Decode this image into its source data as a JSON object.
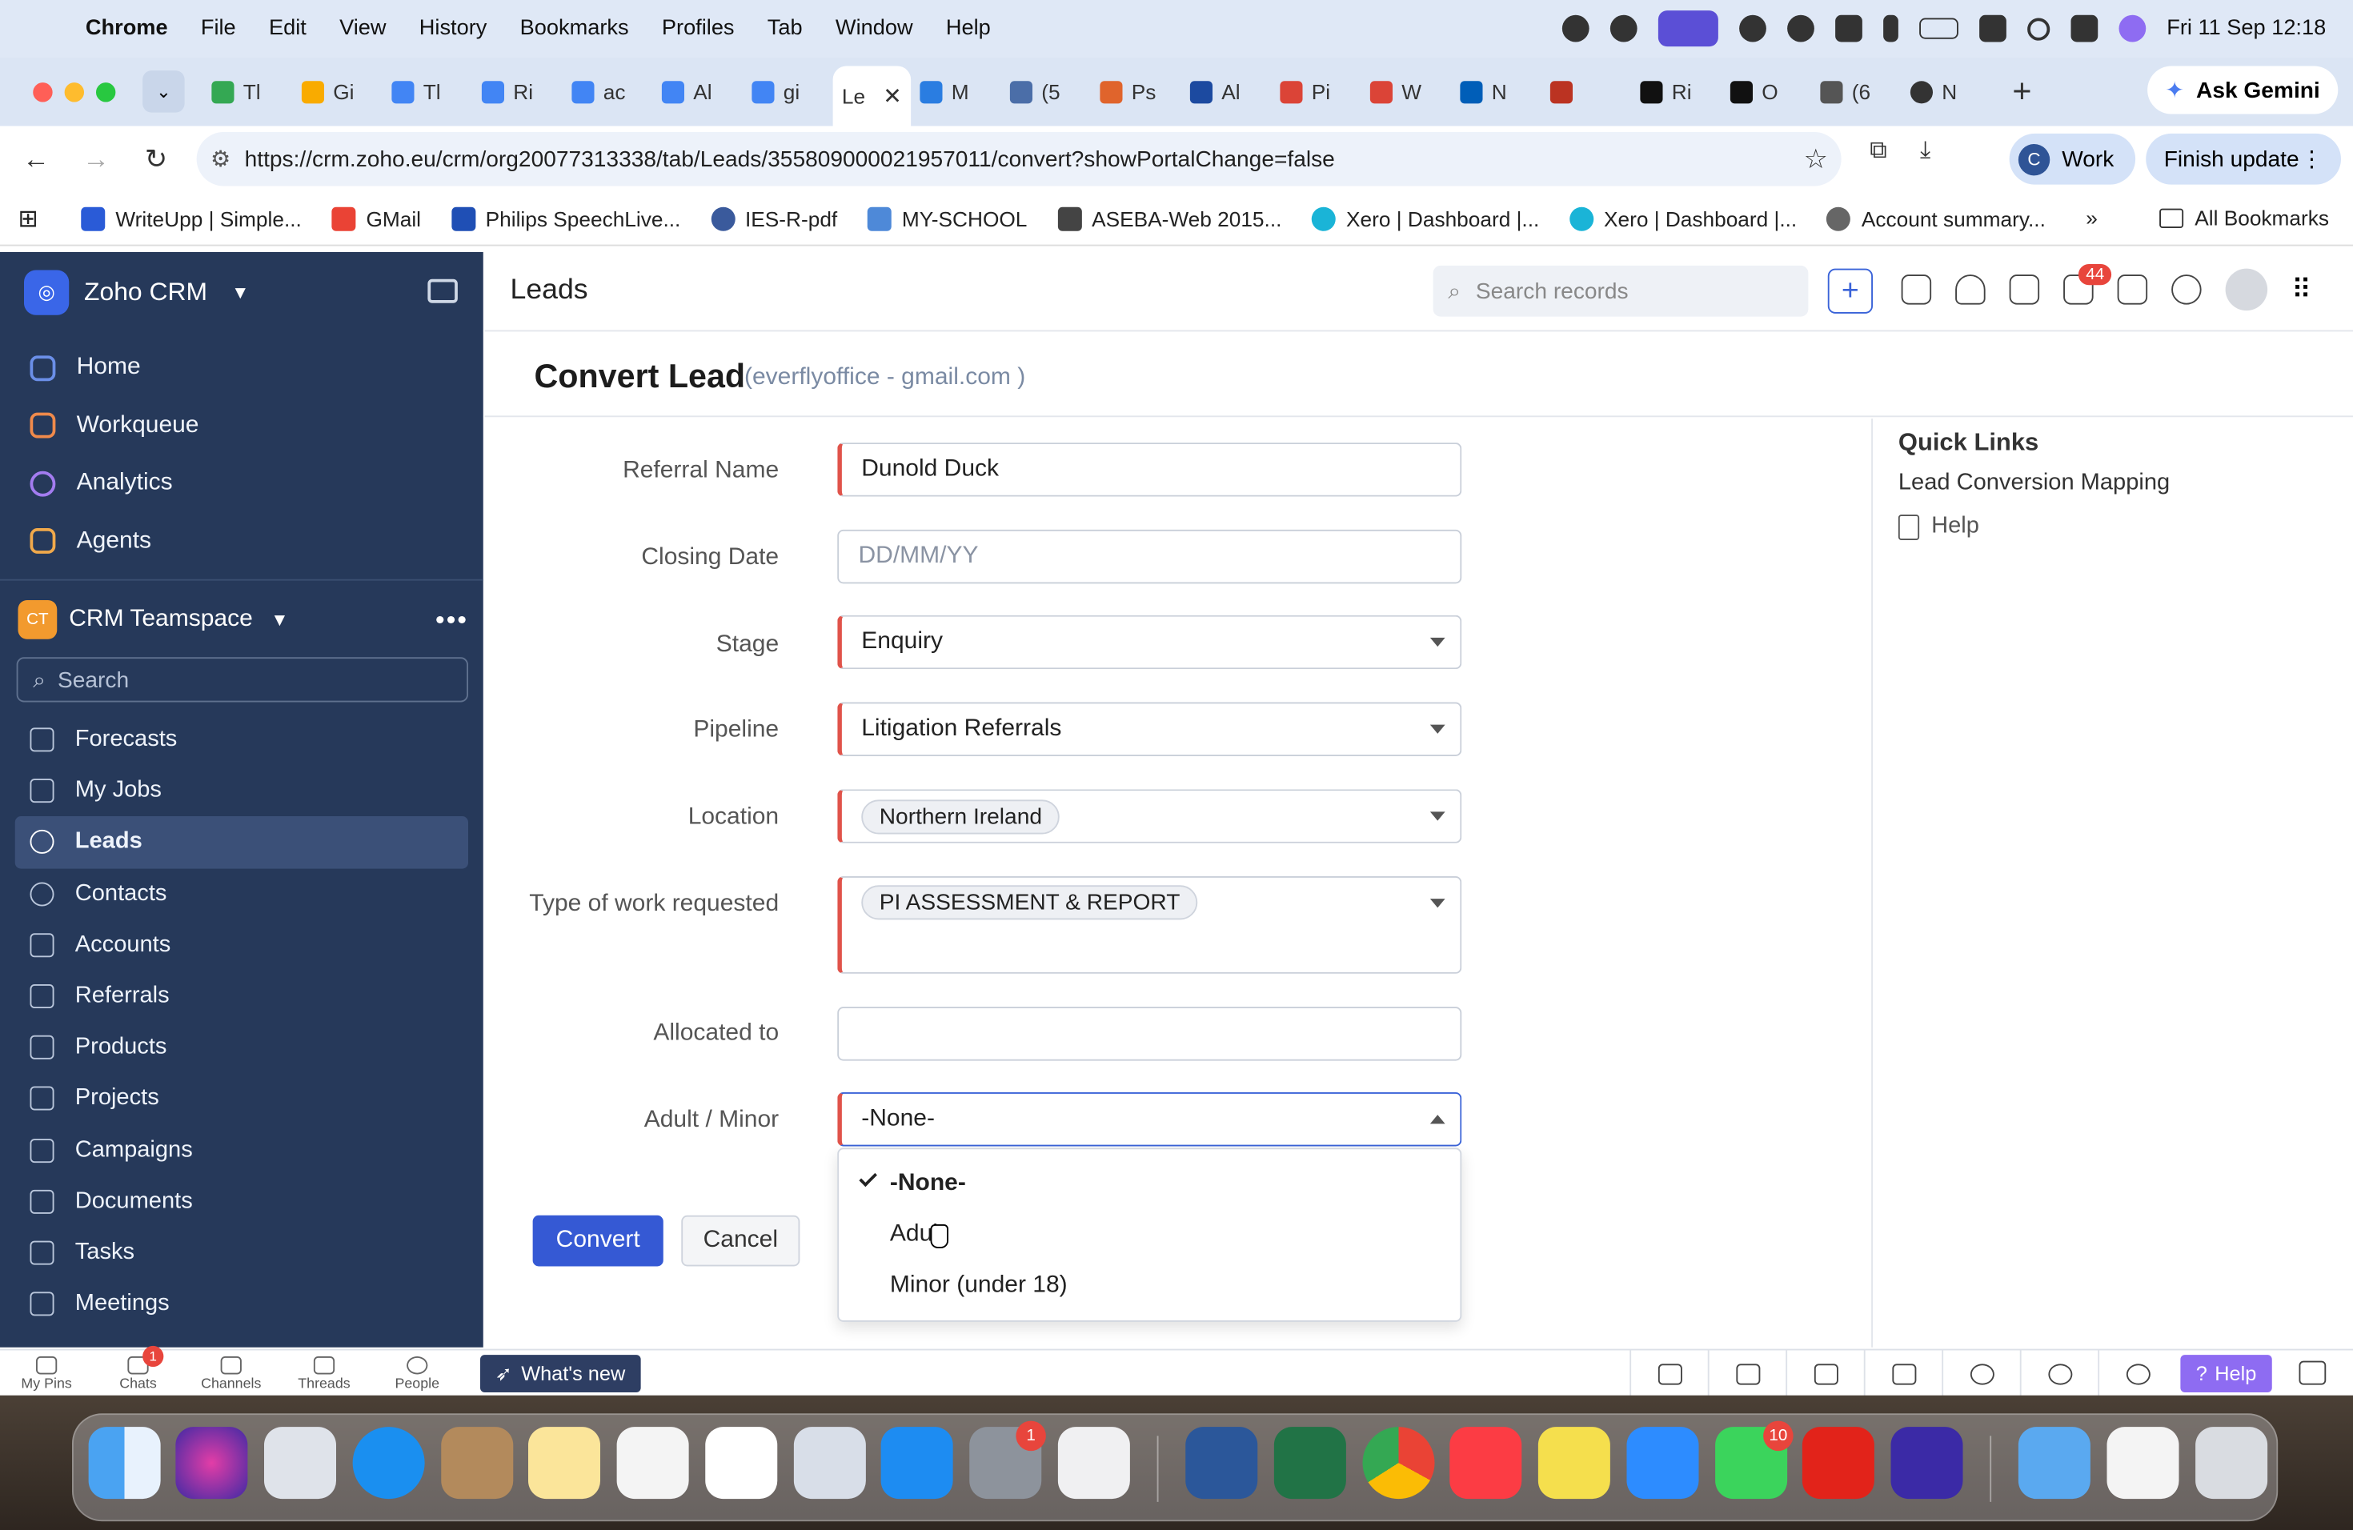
{
  "menubar": {
    "app": "Chrome",
    "items": [
      "File",
      "Edit",
      "View",
      "History",
      "Bookmarks",
      "Profiles",
      "Tab",
      "Window",
      "Help"
    ],
    "datetime": "Fri 11 Sep  12:18"
  },
  "tabs": [
    "Tl",
    "Gi",
    "Tl",
    "Ri",
    "ac",
    "Al",
    "gi",
    "Le",
    "M",
    "(5",
    "Ps",
    "Al",
    "Pi",
    "W",
    "N",
    "",
    "Ri",
    "O",
    "(6",
    "N"
  ],
  "active_tab_index": 7,
  "gemini_label": "Ask Gemini",
  "url": "https://crm.zoho.eu/crm/org20077313338/tab/Leads/355809000021957011/convert?showPortalChange=false",
  "profile": {
    "initial": "C",
    "label": "Work"
  },
  "finish_update": "Finish update",
  "bookmarks": [
    "WriteUpp | Simple...",
    "GMail",
    "Philips SpeechLive...",
    "IES-R-pdf",
    "MY-SCHOOL",
    "ASEBA-Web 2015...",
    "Xero | Dashboard |...",
    "Xero | Dashboard |...",
    "Account summary..."
  ],
  "all_bookmarks": "All Bookmarks",
  "sidebar": {
    "brand": "Zoho CRM",
    "top": [
      "Home",
      "Workqueue",
      "Analytics",
      "Agents"
    ],
    "team_badge": "CT",
    "team": "CRM Teamspace",
    "search_placeholder": "Search",
    "modules": [
      "Forecasts",
      "My Jobs",
      "Leads",
      "Contacts",
      "Accounts",
      "Referrals",
      "Products",
      "Projects",
      "Campaigns",
      "Documents",
      "Tasks",
      "Meetings"
    ],
    "active_module": "Leads"
  },
  "header": {
    "title": "Leads",
    "search_placeholder": "Search records",
    "mail_badge": "44"
  },
  "convert": {
    "title": "Convert Lead",
    "subtitle": "(everflyoffice - gmail.com )"
  },
  "form": {
    "referral_name": {
      "label": "Referral Name",
      "value": "Dunold Duck"
    },
    "closing_date": {
      "label": "Closing Date",
      "placeholder": "DD/MM/YY"
    },
    "stage": {
      "label": "Stage",
      "value": "Enquiry"
    },
    "pipeline": {
      "label": "Pipeline",
      "value": "Litigation Referrals"
    },
    "location": {
      "label": "Location",
      "value": "Northern Ireland"
    },
    "work_type": {
      "label": "Type of work requested",
      "value": "PI ASSESSMENT & REPORT"
    },
    "allocated_to": {
      "label": "Allocated to",
      "value": ""
    },
    "adult_minor": {
      "label": "Adult / Minor",
      "value": "-None-",
      "options": [
        "-None-",
        "Adult",
        "Minor (under 18)"
      ],
      "selected": "-None-"
    },
    "convert_button": "Convert",
    "cancel_button": "Cancel"
  },
  "quick_links": {
    "title": "Quick Links",
    "items": [
      "Lead Conversion Mapping",
      "Help"
    ]
  },
  "bottom_bar": {
    "items": [
      "My Pins",
      "Chats",
      "Channels",
      "Threads",
      "People"
    ],
    "chats_badge": "1",
    "whats_new": "What's new",
    "help": "Help"
  },
  "dock": {
    "settings_badge": "1",
    "facetime_badge": "10"
  }
}
